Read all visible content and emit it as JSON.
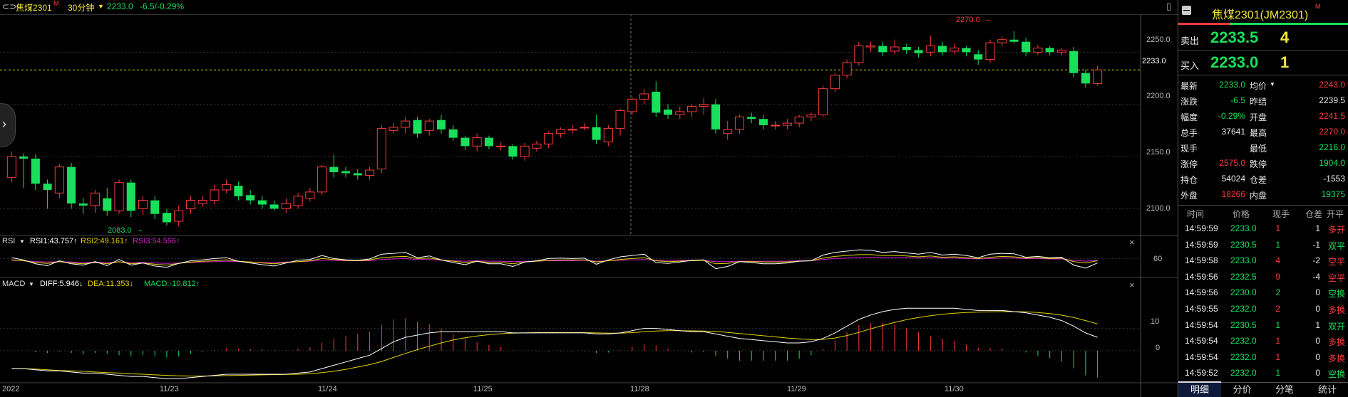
{
  "topbar": {
    "symbol": "焦煤2301",
    "symbol_tag": "M",
    "period": "30分钟",
    "price": "2233.0",
    "change": "-6.5/-0.29%"
  },
  "chart_data": {
    "type": "candlestick",
    "title": "",
    "ylim": [
      2075,
      2285
    ],
    "y_ticks": [
      "2250.0",
      "2200.0",
      "2150.0",
      "2100.0"
    ],
    "y_tick_values": [
      2250,
      2200,
      2150,
      2100
    ],
    "current_price_label": "2233.0",
    "current_price": 2233,
    "high_label": "2270.0",
    "low_label": "2083.0",
    "x_labels": [
      "2022",
      "11/23",
      "11/24",
      "11/25",
      "11/28",
      "11/29",
      "11/30"
    ],
    "candles": [
      [
        2130,
        2150,
        2125,
        2155
      ],
      [
        2150,
        2148,
        2120,
        2153
      ],
      [
        2148,
        2124,
        2118,
        2152
      ],
      [
        2124,
        2118,
        2100,
        2128
      ],
      [
        2115,
        2140,
        2110,
        2143
      ],
      [
        2140,
        2105,
        2100,
        2144
      ],
      [
        2105,
        2103,
        2095,
        2110
      ],
      [
        2103,
        2115,
        2096,
        2118
      ],
      [
        2110,
        2098,
        2093,
        2120
      ],
      [
        2098,
        2125,
        2095,
        2128
      ],
      [
        2125,
        2098,
        2092,
        2128
      ],
      [
        2100,
        2108,
        2094,
        2112
      ],
      [
        2108,
        2095,
        2090,
        2112
      ],
      [
        2096,
        2087,
        2084,
        2100
      ],
      [
        2088,
        2098,
        2083,
        2103
      ],
      [
        2100,
        2108,
        2095,
        2112
      ],
      [
        2105,
        2108,
        2102,
        2112
      ],
      [
        2108,
        2118,
        2104,
        2123
      ],
      [
        2118,
        2123,
        2115,
        2128
      ],
      [
        2122,
        2112,
        2108,
        2126
      ],
      [
        2113,
        2108,
        2104,
        2118
      ],
      [
        2108,
        2104,
        2100,
        2112
      ],
      [
        2104,
        2100,
        2098,
        2108
      ],
      [
        2100,
        2105,
        2096,
        2110
      ],
      [
        2103,
        2112,
        2100,
        2115
      ],
      [
        2110,
        2116,
        2107,
        2120
      ],
      [
        2116,
        2140,
        2113,
        2142
      ],
      [
        2140,
        2135,
        2130,
        2152
      ],
      [
        2136,
        2134,
        2130,
        2140
      ],
      [
        2134,
        2132,
        2128,
        2138
      ],
      [
        2132,
        2137,
        2128,
        2140
      ],
      [
        2138,
        2177,
        2134,
        2180
      ],
      [
        2175,
        2178,
        2172,
        2182
      ],
      [
        2178,
        2184,
        2172,
        2188
      ],
      [
        2185,
        2172,
        2168,
        2188
      ],
      [
        2175,
        2184,
        2170,
        2186
      ],
      [
        2185,
        2176,
        2172,
        2190
      ],
      [
        2176,
        2168,
        2165,
        2180
      ],
      [
        2168,
        2160,
        2156,
        2170
      ],
      [
        2160,
        2168,
        2155,
        2172
      ],
      [
        2168,
        2160,
        2157,
        2170
      ],
      [
        2160,
        2160,
        2156,
        2164
      ],
      [
        2160,
        2150,
        2147,
        2162
      ],
      [
        2150,
        2160,
        2146,
        2163
      ],
      [
        2158,
        2162,
        2155,
        2165
      ],
      [
        2162,
        2172,
        2158,
        2174
      ],
      [
        2172,
        2176,
        2168,
        2178
      ],
      [
        2176,
        2176,
        2172,
        2180
      ],
      [
        2178,
        2178,
        2175,
        2182
      ],
      [
        2178,
        2166,
        2162,
        2190
      ],
      [
        2164,
        2177,
        2160,
        2180
      ],
      [
        2177,
        2194,
        2170,
        2196
      ],
      [
        2193,
        2205,
        2190,
        2207
      ],
      [
        2205,
        2210,
        2200,
        2215
      ],
      [
        2212,
        2192,
        2188,
        2222
      ],
      [
        2195,
        2190,
        2186,
        2200
      ],
      [
        2190,
        2193,
        2186,
        2198
      ],
      [
        2193,
        2198,
        2188,
        2200
      ],
      [
        2198,
        2200,
        2190,
        2206
      ],
      [
        2200,
        2176,
        2172,
        2205
      ],
      [
        2172,
        2176,
        2166,
        2184
      ],
      [
        2176,
        2188,
        2172,
        2190
      ],
      [
        2188,
        2186,
        2182,
        2192
      ],
      [
        2186,
        2180,
        2176,
        2190
      ],
      [
        2180,
        2180,
        2176,
        2184
      ],
      [
        2180,
        2182,
        2176,
        2186
      ],
      [
        2182,
        2188,
        2178,
        2190
      ],
      [
        2188,
        2190,
        2184,
        2192
      ],
      [
        2190,
        2215,
        2188,
        2218
      ],
      [
        2215,
        2228,
        2212,
        2230
      ],
      [
        2228,
        2240,
        2225,
        2243
      ],
      [
        2240,
        2256,
        2237,
        2260
      ],
      [
        2255,
        2256,
        2250,
        2260
      ],
      [
        2256,
        2250,
        2246,
        2260
      ],
      [
        2251,
        2255,
        2248,
        2262
      ],
      [
        2255,
        2252,
        2248,
        2258
      ],
      [
        2252,
        2249,
        2245,
        2255
      ],
      [
        2250,
        2256,
        2246,
        2266
      ],
      [
        2256,
        2250,
        2247,
        2260
      ],
      [
        2251,
        2254,
        2248,
        2258
      ],
      [
        2254,
        2250,
        2246,
        2256
      ],
      [
        2248,
        2243,
        2238,
        2252
      ],
      [
        2243,
        2259,
        2240,
        2262
      ],
      [
        2259,
        2262,
        2256,
        2265
      ],
      [
        2262,
        2260,
        2258,
        2270
      ],
      [
        2260,
        2250,
        2246,
        2264
      ],
      [
        2250,
        2254,
        2247,
        2257
      ],
      [
        2254,
        2250,
        2247,
        2256
      ],
      [
        2250,
        2252,
        2247,
        2254
      ],
      [
        2251,
        2230,
        2226,
        2255
      ],
      [
        2230,
        2220,
        2216,
        2233
      ],
      [
        2220,
        2233,
        2218,
        2237
      ]
    ]
  },
  "rsi": {
    "menu": "RSI",
    "rsi1": "RSI1:43.757↑",
    "rsi2": "RSI2:49.161↑",
    "rsi3": "RSI3:54.556↑",
    "tick": "60",
    "ylim": [
      20,
      90
    ],
    "tick_value": 60,
    "rsi1_values": [
      62,
      57,
      48,
      44,
      55,
      48,
      45,
      53,
      44,
      58,
      45,
      50,
      43,
      40,
      49,
      55,
      57,
      60,
      62,
      54,
      50,
      46,
      43,
      50,
      56,
      58,
      67,
      60,
      57,
      56,
      59,
      70,
      72,
      74,
      62,
      66,
      57,
      51,
      46,
      54,
      48,
      48,
      42,
      52,
      55,
      60,
      61,
      60,
      61,
      47,
      57,
      64,
      67,
      70,
      51,
      49,
      52,
      56,
      57,
      37,
      42,
      53,
      51,
      48,
      48,
      50,
      54,
      55,
      68,
      74,
      77,
      80,
      79,
      74,
      76,
      73,
      70,
      74,
      68,
      70,
      67,
      62,
      70,
      72,
      71,
      63,
      65,
      62,
      63,
      45,
      38,
      50
    ],
    "rsi2_values": [
      57,
      55,
      51,
      49,
      53,
      50,
      48,
      51,
      48,
      53,
      48,
      50,
      47,
      45,
      49,
      52,
      54,
      55,
      57,
      54,
      52,
      50,
      48,
      51,
      53,
      55,
      60,
      58,
      56,
      55,
      57,
      62,
      64,
      65,
      60,
      61,
      57,
      54,
      51,
      54,
      51,
      51,
      48,
      52,
      54,
      56,
      57,
      57,
      57,
      52,
      55,
      58,
      60,
      62,
      55,
      53,
      54,
      55,
      56,
      48,
      49,
      53,
      53,
      52,
      52,
      52,
      54,
      55,
      61,
      65,
      67,
      69,
      69,
      67,
      67,
      66,
      64,
      66,
      63,
      64,
      62,
      60,
      63,
      65,
      64,
      61,
      62,
      60,
      61,
      53,
      50,
      55
    ],
    "rsi3_values": [
      56,
      55,
      53,
      52,
      53,
      52,
      51,
      52,
      51,
      52,
      51,
      51,
      50,
      49,
      50,
      51,
      52,
      53,
      54,
      53,
      52,
      51,
      51,
      52,
      53,
      54,
      56,
      56,
      55,
      55,
      55,
      58,
      59,
      60,
      58,
      58,
      56,
      55,
      54,
      55,
      54,
      54,
      53,
      54,
      54,
      55,
      55,
      55,
      56,
      54,
      55,
      56,
      57,
      58,
      56,
      56,
      56,
      56,
      56,
      53,
      53,
      54,
      54,
      54,
      54,
      54,
      55,
      55,
      58,
      60,
      61,
      62,
      63,
      62,
      62,
      62,
      61,
      62,
      61,
      61,
      60,
      59,
      60,
      61,
      61,
      60,
      60,
      59,
      59,
      56,
      54,
      56
    ]
  },
  "macd": {
    "menu": "MACD",
    "diff": "DIFF:5.946↓",
    "dea": "DEA:11.353↓",
    "macd": "MACD:-10.812↑",
    "tick10": "10",
    "tick0": "0",
    "ylim": [
      -14,
      28
    ],
    "tick10_value": 10,
    "tick0_value": 0,
    "diff_values": [
      -8,
      -8,
      -8.5,
      -9,
      -9,
      -9.5,
      -10,
      -10,
      -10.5,
      -11,
      -11.5,
      -11.5,
      -12,
      -12.5,
      -12.5,
      -12,
      -11.5,
      -11,
      -10.5,
      -10.5,
      -10.5,
      -10.5,
      -10.5,
      -10.5,
      -10,
      -9.5,
      -8,
      -6.5,
      -5,
      -3.5,
      -2,
      1,
      4,
      6,
      7,
      8,
      8.5,
      8.5,
      8.5,
      8.5,
      8.5,
      8.5,
      8,
      8,
      8,
      8,
      8,
      8,
      8,
      7.5,
      7.5,
      8,
      9,
      10,
      10,
      9.5,
      9,
      8.5,
      8.5,
      7.5,
      6.5,
      5.5,
      5,
      4.5,
      4,
      3.5,
      3.5,
      4,
      5.5,
      8,
      11,
      14,
      16,
      17.5,
      18.5,
      19,
      19,
      19,
      19,
      19,
      18.5,
      18,
      18,
      18,
      17.5,
      17,
      16,
      15,
      13.5,
      11,
      8,
      6
    ],
    "dea_values": [
      -8,
      -8,
      -8.2,
      -8.5,
      -8.8,
      -9,
      -9.2,
      -9.5,
      -9.8,
      -10,
      -10.3,
      -10.5,
      -10.8,
      -11,
      -11.2,
      -11.3,
      -11.3,
      -11.2,
      -11.1,
      -11,
      -10.9,
      -10.8,
      -10.7,
      -10.6,
      -10.5,
      -10.3,
      -9.8,
      -9.2,
      -8.3,
      -7.3,
      -6.2,
      -4.8,
      -3,
      -1.2,
      0.5,
      2,
      3.5,
      4.8,
      5.8,
      6.6,
      7.2,
      7.6,
      7.9,
      8,
      8.1,
      8.1,
      8.1,
      8.1,
      8.1,
      8,
      7.9,
      7.9,
      8.1,
      8.5,
      8.8,
      9,
      9,
      8.9,
      8.8,
      8.6,
      8.2,
      7.7,
      7.2,
      6.7,
      6.2,
      5.7,
      5.3,
      5,
      5.1,
      5.7,
      6.8,
      8.2,
      9.8,
      11.3,
      12.7,
      13.9,
      14.9,
      15.7,
      16.3,
      16.8,
      17.1,
      17.3,
      17.4,
      17.5,
      17.5,
      17.4,
      17.1,
      16.6,
      15.9,
      14.9,
      13.5,
      12
    ],
    "hist_values": [
      0,
      0,
      -0.6,
      -1,
      -0.4,
      -1,
      -1.6,
      -1,
      -1.4,
      -2,
      -2.4,
      -2,
      -2.4,
      -3,
      -2.6,
      -1.4,
      -0.4,
      0.4,
      1.2,
      1,
      0.8,
      0.6,
      0.4,
      0.2,
      1,
      1.6,
      3.6,
      5.4,
      6.6,
      7.6,
      8.4,
      11.6,
      14,
      14.4,
      13,
      12,
      10,
      7.4,
      5.4,
      3.8,
      2.6,
      1.8,
      0.2,
      0,
      -0.2,
      -0.2,
      -0.2,
      -0.2,
      -0.2,
      -1,
      -0.8,
      0.2,
      1.8,
      3,
      2.4,
      1,
      0,
      -0.8,
      -0.6,
      -2.2,
      -3.4,
      -4.4,
      -4.4,
      -4.4,
      -4.4,
      -4.4,
      -3.6,
      -2,
      0.8,
      4.6,
      8.4,
      11.6,
      12.4,
      12.4,
      11.6,
      10.2,
      8.2,
      6.6,
      5.4,
      4.4,
      2.8,
      1.4,
      1.2,
      1,
      0,
      -0.8,
      -2.2,
      -3.2,
      -4.8,
      -7.8,
      -11,
      -12
    ]
  },
  "right": {
    "title": "焦煤2301(JM2301)",
    "title_tag": "M",
    "sell_label": "卖出",
    "sell_price": "2233.5",
    "sell_vol": "4",
    "buy_label": "买入",
    "buy_price": "2233.0",
    "buy_vol": "1",
    "quote": [
      {
        "l1": "最新",
        "v1": "2233.0",
        "c1": "green",
        "l2": "均价",
        "v2": "2243.0",
        "c2": "red"
      },
      {
        "l1": "涨跌",
        "v1": "-6.5",
        "c1": "green",
        "l2": "昨结",
        "v2": "2239.5",
        "c2": "white"
      },
      {
        "l1": "幅度",
        "v1": "-0.29%",
        "c1": "green",
        "l2": "开盘",
        "v2": "2241.5",
        "c2": "red"
      },
      {
        "l1": "总手",
        "v1": "37641",
        "c1": "white",
        "l2": "最高",
        "v2": "2270.0",
        "c2": "red"
      },
      {
        "l1": "现手",
        "v1": "",
        "c1": "white",
        "l2": "最低",
        "v2": "2216.0",
        "c2": "green"
      },
      {
        "l1": "涨停",
        "v1": "2575.0",
        "c1": "red",
        "l2": "跌停",
        "v2": "1904.0",
        "c2": "green"
      },
      {
        "l1": "持仓",
        "v1": "54024",
        "c1": "white",
        "l2": "仓差",
        "v2": "-1553",
        "c2": "white"
      },
      {
        "l1": "外盘",
        "v1": "18266",
        "c1": "red",
        "l2": "内盘",
        "v2": "19375",
        "c2": "green"
      }
    ],
    "trade_headers": [
      "时间",
      "价格",
      "现手",
      "仓差",
      "开平"
    ],
    "trades": [
      {
        "time": "14:59:59",
        "price": "2233.0",
        "pc": "green",
        "vol": "1",
        "vc": "red",
        "diff": "1",
        "kind": "多开",
        "kc": "red"
      },
      {
        "time": "14:59:59",
        "price": "2230.5",
        "pc": "green",
        "vol": "1",
        "vc": "green",
        "diff": "-1",
        "kind": "双平",
        "kc": "green"
      },
      {
        "time": "14:59:58",
        "price": "2233.0",
        "pc": "green",
        "vol": "4",
        "vc": "red",
        "diff": "-2",
        "kind": "空平",
        "kc": "red"
      },
      {
        "time": "14:59:56",
        "price": "2232.5",
        "pc": "green",
        "vol": "9",
        "vc": "red",
        "diff": "-4",
        "kind": "空平",
        "kc": "red"
      },
      {
        "time": "14:59:56",
        "price": "2230.0",
        "pc": "green",
        "vol": "2",
        "vc": "green",
        "diff": "0",
        "kind": "空换",
        "kc": "green"
      },
      {
        "time": "14:59:55",
        "price": "2232.0",
        "pc": "green",
        "vol": "2",
        "vc": "red",
        "diff": "0",
        "kind": "多换",
        "kc": "red"
      },
      {
        "time": "14:59:54",
        "price": "2230.5",
        "pc": "green",
        "vol": "1",
        "vc": "green",
        "diff": "1",
        "kind": "双开",
        "kc": "green"
      },
      {
        "time": "14:59:54",
        "price": "2232.0",
        "pc": "green",
        "vol": "1",
        "vc": "red",
        "diff": "0",
        "kind": "多换",
        "kc": "red"
      },
      {
        "time": "14:59:54",
        "price": "2232.0",
        "pc": "green",
        "vol": "1",
        "vc": "red",
        "diff": "0",
        "kind": "多换",
        "kc": "red"
      },
      {
        "time": "14:59:52",
        "price": "2232.0",
        "pc": "green",
        "vol": "1",
        "vc": "green",
        "diff": "0",
        "kind": "空换",
        "kc": "green"
      }
    ],
    "tabs": [
      "明细",
      "分价",
      "分笔",
      "统计"
    ]
  },
  "colors": {
    "up": "#ff3b3b",
    "down": "#19e05a",
    "diff": "#ffffff",
    "dea": "#e6d200",
    "rsi3": "#d020d0"
  }
}
